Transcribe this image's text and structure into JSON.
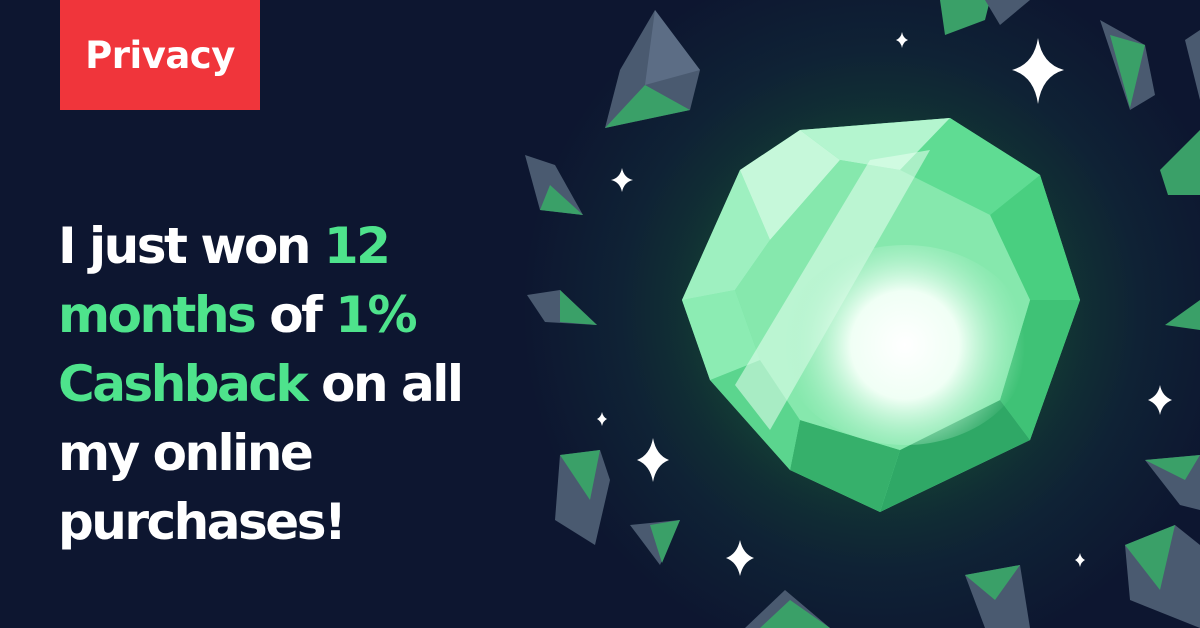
{
  "brand": {
    "label": "Privacy"
  },
  "headline": {
    "part1": "I just won ",
    "highlight1": "12 months",
    "part2": " of ",
    "highlight2": "1% Cashback",
    "part3": " on all my online purchases!"
  },
  "colors": {
    "background": "#0d1630",
    "badge": "#f0353b",
    "highlight": "#4ee38c",
    "text": "#ffffff"
  },
  "icons": [
    "gem-icon",
    "sparkle-icon",
    "crystal-shard-icon"
  ]
}
